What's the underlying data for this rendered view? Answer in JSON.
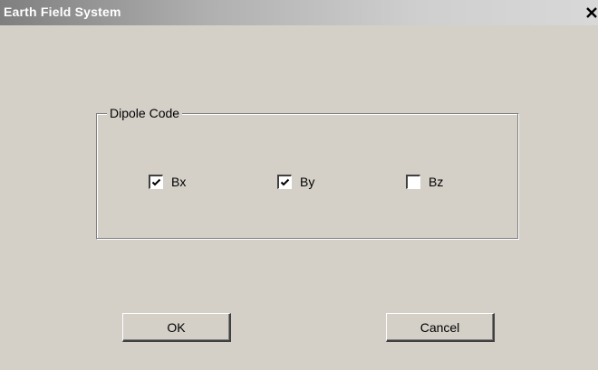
{
  "window": {
    "title": "Earth Field System",
    "close_glyph": "✕"
  },
  "dipole_group": {
    "label": "Dipole Code",
    "checkboxes": [
      {
        "label": "Bx",
        "checked": true
      },
      {
        "label": "By",
        "checked": true
      },
      {
        "label": "Bz",
        "checked": false
      }
    ]
  },
  "buttons": {
    "ok_label": "OK",
    "cancel_label": "Cancel"
  },
  "colors": {
    "dialog_face": "#d4d0c8",
    "title_inactive_start": "#7f7f7f",
    "title_inactive_end": "#d8d8d8"
  }
}
